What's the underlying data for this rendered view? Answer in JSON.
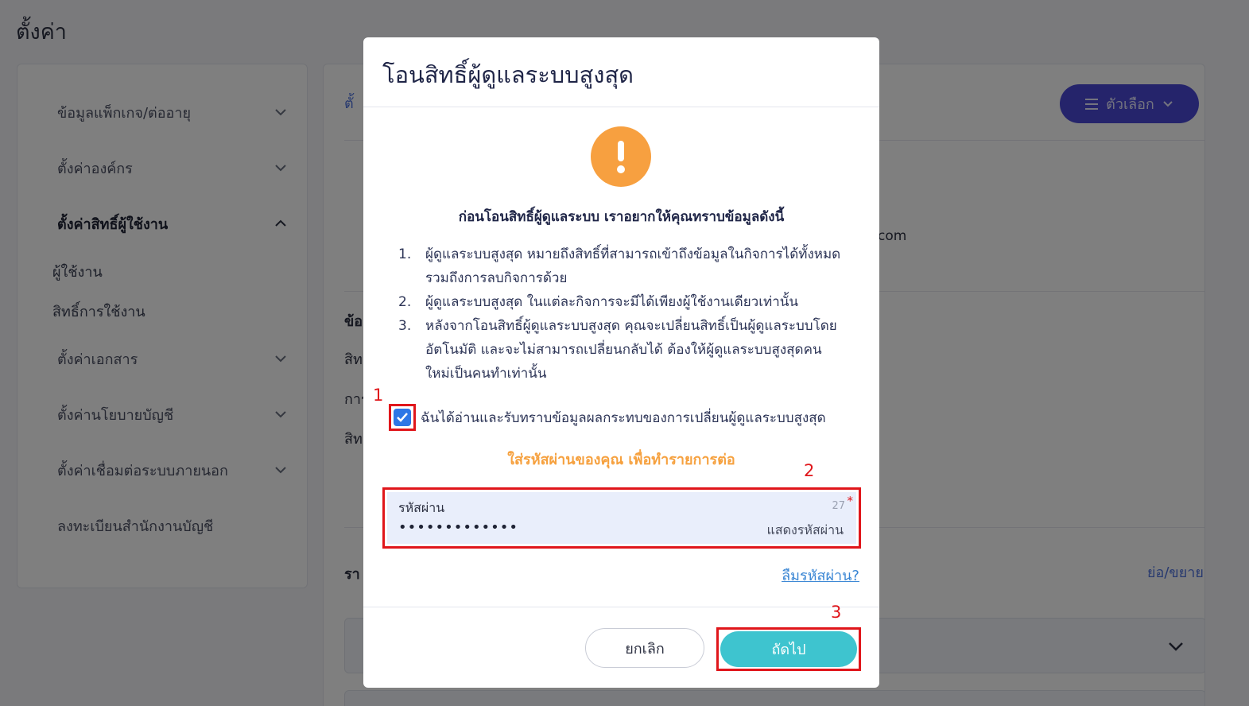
{
  "page": {
    "title": "ตั้งค่า"
  },
  "sidebar": {
    "items": [
      {
        "label": "ข้อมูลแพ็กเกจ/ต่ออายุ"
      },
      {
        "label": "ตั้งค่าองค์กร"
      },
      {
        "label": "ตั้งค่าสิทธิ์ผู้ใช้งาน"
      },
      {
        "label": "ตั้งค่าเอกสาร"
      },
      {
        "label": "ตั้งค่านโยบายบัญชี"
      },
      {
        "label": "ตั้งค่าเชื่อมต่อระบบภายนอก"
      },
      {
        "label": "ลงทะเบียนสำนักงานบัญชี"
      }
    ],
    "subitems": [
      {
        "label": "ผู้ใช้งาน"
      },
      {
        "label": "สิทธิ์การใช้งาน"
      }
    ]
  },
  "main": {
    "tab_label": "ตั้",
    "options_button": "ตัวเลือก",
    "email_suffix": "com",
    "section_head": "ข้อ",
    "row1": "สิท",
    "row2": "การ",
    "row3": "สิท",
    "list_head": "รา",
    "toggle_link": "ย่อ/ขยาย"
  },
  "modal": {
    "title": "โอนสิทธิ์ผู้ดูแลระบบสูงสุด",
    "heading": "ก่อนโอนสิทธิ์ผู้ดูแลระบบ เราอยากให้คุณทราบข้อมูลดังนี้",
    "notices": [
      {
        "num": "1.",
        "text": "ผู้ดูแลระบบสูงสุด หมายถึงสิทธิ์ที่สามารถเข้าถึงข้อมูลในกิจการได้ทั้งหมด รวมถึงการลบกิจการด้วย"
      },
      {
        "num": "2.",
        "text": "ผู้ดูแลระบบสูงสุด ในแต่ละกิจการจะมีได้เพียงผู้ใช้งานเดียวเท่านั้น"
      },
      {
        "num": "3.",
        "text": "หลังจากโอนสิทธิ์ผู้ดูแลระบบสูงสุด คุณจะเปลี่ยนสิทธิ์เป็นผู้ดูแลระบบโดยอัตโนมัติ และจะไม่สามารถเปลี่ยนกลับได้ ต้องให้ผู้ดูแลระบบสูงสุดคนใหม่เป็นคนทำเท่านั้น"
      }
    ],
    "acknowledge": "ฉันได้อ่านและรับทราบข้อมูลผลกระทบของการเปลี่ยนผู้ดูแลระบบสูงสุด",
    "acknowledged": true,
    "password_hint": "ใส่รหัสผ่านของคุณ เพื่อทำรายการต่อ",
    "password": {
      "label": "รหัสผ่าน",
      "masked_value": "•••••••••••••",
      "char_count": "27",
      "required_mark": "*",
      "show_label": "แสดงรหัสผ่าน"
    },
    "forgot_link": "ลืมรหัสผ่าน?",
    "cancel_button": "ยกเลิก",
    "next_button": "ถัดไป"
  },
  "annotations": [
    "1",
    "2",
    "3"
  ],
  "colors": {
    "warning": "#f7a040",
    "primary_button": "#3ec4cf",
    "options_button": "#4a48d6",
    "highlight_box": "#e0161b",
    "checkbox": "#2e77e6",
    "hint_text": "#f6a13f"
  }
}
